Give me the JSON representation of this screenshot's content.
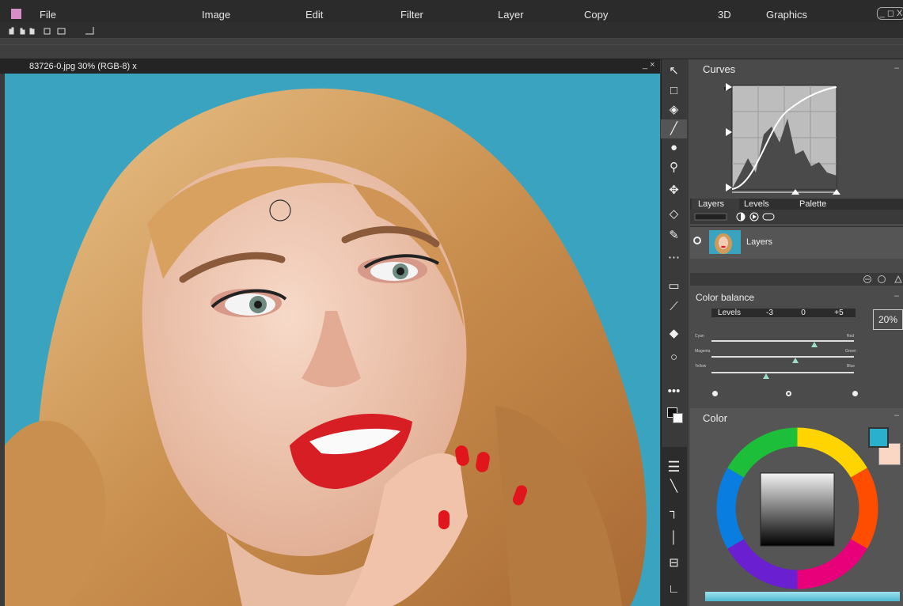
{
  "menubar": {
    "items": [
      "File",
      "Image",
      "Edit",
      "Filter",
      "Layer",
      "Copy",
      "3D",
      "Graphics"
    ],
    "window_controls": "_ ◻ X"
  },
  "document": {
    "tab_label": "83726-0.jpg 30% (RGB-8) x",
    "controls": "_ ×"
  },
  "panels": {
    "curves": {
      "title": "Curves",
      "min": "–"
    },
    "tabs": [
      "Layers",
      "Levels",
      "Palette"
    ],
    "layers": {
      "layer_name": "Layers"
    },
    "color_balance": {
      "title": "Color balance",
      "header_cells": [
        "Levels",
        "-3",
        "0",
        "+5"
      ],
      "sliders": [
        {
          "left": "Cyan",
          "right": "Red",
          "value": 0.72
        },
        {
          "left": "Magenta",
          "right": "Green",
          "value": 0.6
        },
        {
          "left": "Yellow",
          "right": "Blue",
          "value": 0.38
        }
      ],
      "percent": "20%"
    },
    "color": {
      "title": "Color",
      "foreground": "#2ab0cc",
      "background": "#f9d7c4"
    }
  },
  "colors": {
    "canvas_bg": "#3aa4c0",
    "accent": "#d58fc8"
  }
}
